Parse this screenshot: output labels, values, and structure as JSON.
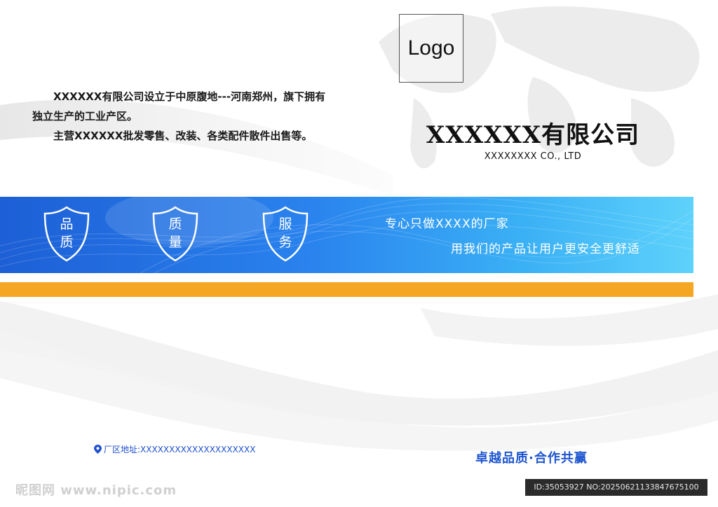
{
  "intro": {
    "line1": "XXXXXX有限公司设立于中原腹地---河南郑州，旗下拥有独立生产的工业产区。",
    "line2": "主营XXXXXX批发零售、改装、各类配件散件出售等。"
  },
  "logo": {
    "label": "Logo"
  },
  "company": {
    "name": "XXXXXX有限公司",
    "english": "XXXXXXXX CO., LTD"
  },
  "banner": {
    "shields": [
      {
        "text": "品质",
        "icon": "shield-icon"
      },
      {
        "text": "质量",
        "icon": "shield-icon"
      },
      {
        "text": "服务",
        "icon": "shield-icon"
      }
    ],
    "slogan1": "专心只做XXXX的厂家",
    "slogan2": "用我们的产品让用户更安全更舒适"
  },
  "footer": {
    "address": "厂区地址:XXXXXXXXXXXXXXXXXXXX",
    "address_icon": "location-pin-icon",
    "motto": "卓越品质·合作共赢"
  },
  "watermark": {
    "site": "昵图网 www.nipic.com",
    "id_text": "ID:35053927 NO:20250621133847675100"
  },
  "colors": {
    "banner_start": "#1d5fd6",
    "banner_end": "#5ed2fb",
    "accent_orange": "#f5a623",
    "text_blue": "#1e55d0"
  }
}
